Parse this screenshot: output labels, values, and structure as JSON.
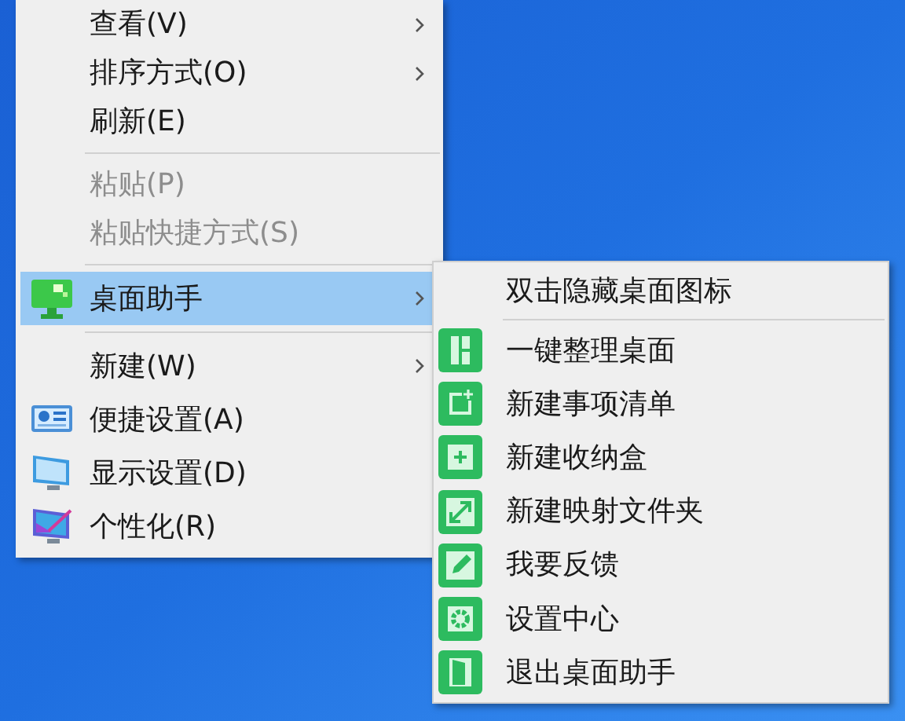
{
  "context_menu": {
    "items": [
      {
        "kind": "item",
        "label": "查看(V)",
        "submenu": true,
        "disabled": false,
        "selected": false
      },
      {
        "kind": "item",
        "label": "排序方式(O)",
        "submenu": true,
        "disabled": false,
        "selected": false
      },
      {
        "kind": "item",
        "label": "刷新(E)",
        "submenu": false,
        "disabled": false,
        "selected": false
      },
      {
        "kind": "separator"
      },
      {
        "kind": "item",
        "label": "粘贴(P)",
        "submenu": false,
        "disabled": true,
        "selected": false
      },
      {
        "kind": "item",
        "label": "粘贴快捷方式(S)",
        "submenu": false,
        "disabled": true,
        "selected": false
      },
      {
        "kind": "separator"
      },
      {
        "kind": "item",
        "label": "桌面助手",
        "submenu": true,
        "disabled": false,
        "selected": true
      },
      {
        "kind": "separator"
      },
      {
        "kind": "item",
        "label": "新建(W)",
        "submenu": true,
        "disabled": false,
        "selected": false
      },
      {
        "kind": "item",
        "label": "便捷设置(A)",
        "submenu": false,
        "disabled": false,
        "selected": false
      },
      {
        "kind": "item",
        "label": "显示设置(D)",
        "submenu": false,
        "disabled": false,
        "selected": false
      },
      {
        "kind": "item",
        "label": "个性化(R)",
        "submenu": false,
        "disabled": false,
        "selected": false
      }
    ]
  },
  "submenu": {
    "items": [
      {
        "kind": "item",
        "label": "双击隐藏桌面图标"
      },
      {
        "kind": "separator"
      },
      {
        "kind": "item",
        "label": "一键整理桌面"
      },
      {
        "kind": "item",
        "label": "新建事项清单"
      },
      {
        "kind": "item",
        "label": "新建收纳盒"
      },
      {
        "kind": "item",
        "label": "新建映射文件夹"
      },
      {
        "kind": "item",
        "label": "我要反馈"
      },
      {
        "kind": "item",
        "label": "设置中心"
      },
      {
        "kind": "item",
        "label": "退出桌面助手"
      }
    ]
  }
}
